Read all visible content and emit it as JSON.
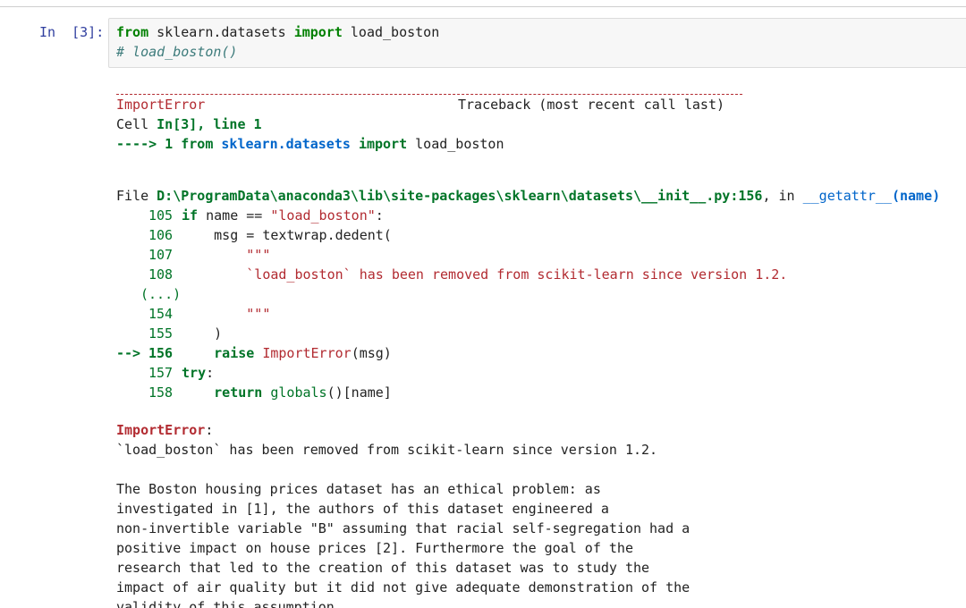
{
  "cell": {
    "prompt": "In  [3]:",
    "code": {
      "line1_kw_from": "from",
      "line1_module": " sklearn.datasets ",
      "line1_kw_import": "import",
      "line1_name": " load_boston",
      "line2_comment": "# load_boston()"
    }
  },
  "traceback": {
    "error_name": "ImportError",
    "traceback_header": "Traceback (most recent call last)",
    "cell_label": "Cell ",
    "cell_ref": "In[3], line 1",
    "arrow1": "---->",
    "arrow1_lineno": " 1 ",
    "arrow1_from": "from",
    "arrow1_module": " sklearn.datasets ",
    "arrow1_import": "import",
    "arrow1_name": " load_boston",
    "file_label": "File ",
    "file_path": "D:\\ProgramData\\anaconda3\\lib\\site-packages\\sklearn\\datasets\\__init__.py:156",
    "file_in": ", in ",
    "func_name": "__getattr__",
    "func_args": "(name)",
    "lines": [
      {
        "no": "105",
        "parts": [
          {
            "t": " ",
            "c": ""
          },
          {
            "t": "if",
            "c": "greenb"
          },
          {
            "t": " name == ",
            "c": ""
          },
          {
            "t": "\"load_boston\"",
            "c": "red"
          },
          {
            "t": ":",
            "c": ""
          }
        ]
      },
      {
        "no": "106",
        "parts": [
          {
            "t": "     msg = textwrap.dedent(",
            "c": ""
          }
        ]
      },
      {
        "no": "107",
        "parts": [
          {
            "t": "         ",
            "c": ""
          },
          {
            "t": "\"\"\"",
            "c": "red"
          }
        ]
      },
      {
        "no": "108",
        "parts": [
          {
            "t": "         ",
            "c": ""
          },
          {
            "t": "`load_boston` has been removed from scikit-learn since version 1.2.",
            "c": "red"
          }
        ]
      },
      {
        "no": "(...)",
        "parts": []
      },
      {
        "no": "154",
        "parts": [
          {
            "t": "         ",
            "c": ""
          },
          {
            "t": "\"\"\"",
            "c": "red"
          }
        ]
      },
      {
        "no": "155",
        "parts": [
          {
            "t": "     )",
            "c": ""
          }
        ]
      },
      {
        "no": "156",
        "arrow": "--> ",
        "parts": [
          {
            "t": "     ",
            "c": ""
          },
          {
            "t": "raise",
            "c": "greenb"
          },
          {
            "t": " ",
            "c": ""
          },
          {
            "t": "ImportError",
            "c": "red"
          },
          {
            "t": "(msg)",
            "c": ""
          }
        ]
      },
      {
        "no": "157",
        "parts": [
          {
            "t": " ",
            "c": ""
          },
          {
            "t": "try",
            "c": "greenb"
          },
          {
            "t": ":",
            "c": ""
          }
        ]
      },
      {
        "no": "158",
        "parts": [
          {
            "t": "     ",
            "c": ""
          },
          {
            "t": "return",
            "c": "greenb"
          },
          {
            "t": " ",
            "c": ""
          },
          {
            "t": "globals",
            "c": "green"
          },
          {
            "t": "()[name]",
            "c": ""
          }
        ]
      }
    ],
    "final_error": "ImportError",
    "final_colon": ":",
    "message_lines": [
      "`load_boston` has been removed from scikit-learn since version 1.2.",
      "",
      "The Boston housing prices dataset has an ethical problem: as",
      "investigated in [1], the authors of this dataset engineered a",
      "non-invertible variable \"B\" assuming that racial self-segregation had a",
      "positive impact on house prices [2]. Furthermore the goal of the",
      "research that led to the creation of this dataset was to study the",
      "impact of air quality but it did not give adequate demonstration of the",
      "validity of this assumption."
    ]
  }
}
